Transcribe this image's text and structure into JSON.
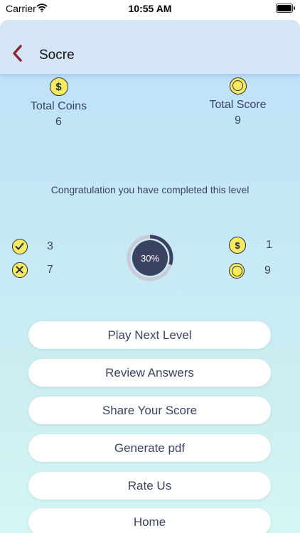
{
  "status_bar": {
    "carrier": "Carrier",
    "time": "10:55 AM"
  },
  "nav": {
    "title": "Socre"
  },
  "stats": {
    "total_coins_label": "Total Coins",
    "total_coins_value": "6",
    "total_score_label": "Total Score",
    "total_score_value": "9"
  },
  "congrats_text": "Congratulation you have completed this level",
  "results": {
    "correct": "3",
    "wrong": "7",
    "coins": "1",
    "score": "9",
    "progress_label": "30%",
    "progress_fraction": 0.3
  },
  "buttons": {
    "play_next": "Play Next Level",
    "review": "Review Answers",
    "share": "Share Your Score",
    "pdf": "Generate pdf",
    "rate": "Rate Us",
    "home": "Home"
  },
  "colors": {
    "accent_dark": "#3b4260",
    "coin_yellow": "#f7ea5f",
    "back_arrow": "#8a2436",
    "progress_track": "#c9ccd6"
  }
}
